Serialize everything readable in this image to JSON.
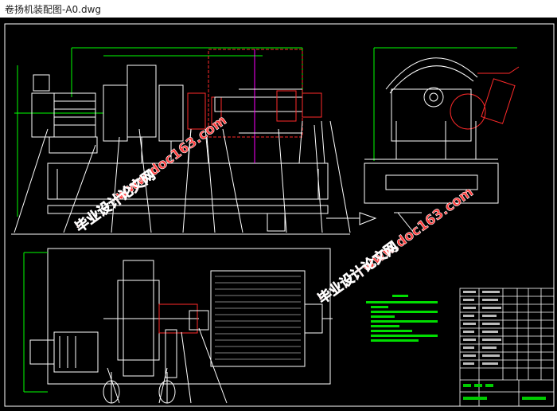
{
  "window": {
    "title": "卷扬机装配图-A0.dwg"
  },
  "watermarks": {
    "site": "www.doc163.com",
    "brand": "毕业设计论文网"
  },
  "colors": {
    "background": "#000000",
    "line_white": "#ffffff",
    "line_red": "#ff2a2a",
    "line_green": "#00ff00",
    "line_yellow": "#ffff00",
    "line_magenta": "#ff00ff",
    "watermark": "#ff3b3b"
  }
}
